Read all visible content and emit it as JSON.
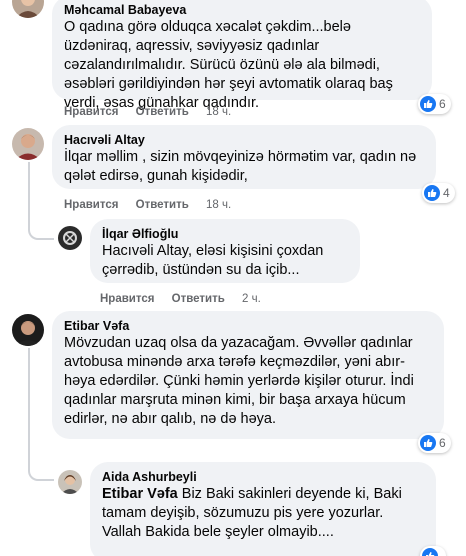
{
  "comments": [
    {
      "author": "Məhcamal Babayeva",
      "text": "O qadına görə olduqca xəcalət çəkdim...belə üzdəniraq, aqressiv, səviyyəsiz qadınlar cəzalandırılmalıdır. Sürücü özünü ələ ala bilmədi, əsəbləri gərildiyindən hər şeyi avtomatik olaraq baş verdi, əsas günahkar qadındır.",
      "like_label": "Нравится",
      "reply_label": "Ответить",
      "time": "18 ч.",
      "reaction_count": "6"
    },
    {
      "author": "Hacıvəli Altay",
      "text": "İlqar məllim , sizin mövqeyinizə hörmətim var, qadın nə qələt edirsə, gunah kişidədir,",
      "like_label": "Нравится",
      "reply_label": "Ответить",
      "time": "18 ч.",
      "reaction_count": "4"
    },
    {
      "author": "İlqar Əlfioğlu",
      "text": "Hacıvəli Altay, eləsi kişisini çoxdan çərrədib, üstündən su da içib...",
      "like_label": "Нравится",
      "reply_label": "Ответить",
      "time": "2 ч."
    },
    {
      "author": "Etibar Vəfa",
      "text": "Mövzudan uzaq olsa da yazacağam. Əvvəllər qadınlar avtobusa minəndə arxa tərəfə keçməzdilər, yəni abır-həya edərdilər. Çünki həmin yerlərdə kişilər oturur. İndi qadınlar marşruta minən kimi, bir başa arxaya hücum edirlər, nə abır qalıb, nə də həya.",
      "like_label": "Нравится",
      "reply_label": "Ответить",
      "time": "18 ч.",
      "reaction_count": "6"
    },
    {
      "author": "Aida Ashurbeyli",
      "mention": "Etibar Vəfa",
      "text": " Biz Baki sakinleri deyende ki, Baki tamam deyişib, sözumuzu pis yere yozurlar. Vallah Bakida bele şeyler olmayib...."
    }
  ],
  "colors": {
    "bubble": "#f0f2f5",
    "like_blue": "#1877f2",
    "meta_gray": "#65676b"
  }
}
